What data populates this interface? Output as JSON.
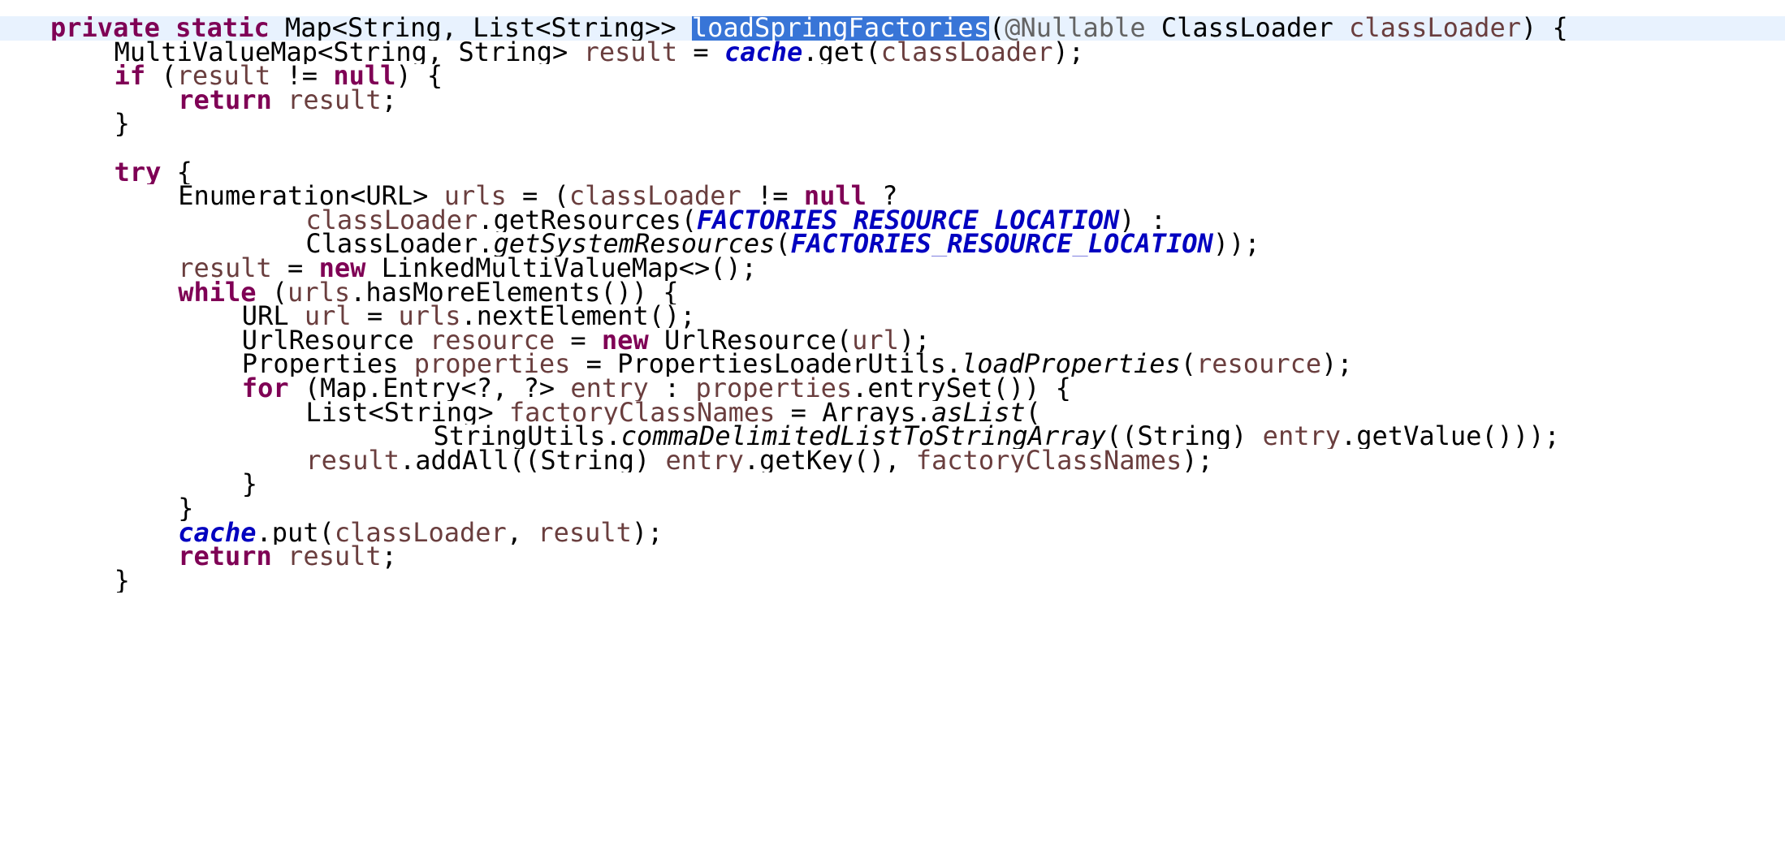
{
  "editor": {
    "lines": [
      {
        "indent": 0,
        "current": true,
        "tokens": [
          {
            "t": "private",
            "s": "kw"
          },
          {
            "t": " "
          },
          {
            "t": "static",
            "s": "kw"
          },
          {
            "t": " Map<String, List<String>> "
          },
          {
            "t": "loadSpringFactories",
            "s": "sel"
          },
          {
            "t": "("
          },
          {
            "t": "@Nullable",
            "s": "ann"
          },
          {
            "t": " ClassLoader "
          },
          {
            "t": "classLoader",
            "s": "var"
          },
          {
            "t": ") {"
          }
        ]
      },
      {
        "indent": 1,
        "tokens": [
          {
            "t": "MultiValueMap<String, String> "
          },
          {
            "t": "result",
            "s": "var"
          },
          {
            "t": " = "
          },
          {
            "t": "cache",
            "s": "field"
          },
          {
            "t": ".get("
          },
          {
            "t": "classLoader",
            "s": "var"
          },
          {
            "t": ");"
          }
        ]
      },
      {
        "indent": 1,
        "tokens": [
          {
            "t": "if",
            "s": "kw"
          },
          {
            "t": " ("
          },
          {
            "t": "result",
            "s": "var"
          },
          {
            "t": " != "
          },
          {
            "t": "null",
            "s": "kw"
          },
          {
            "t": ") {"
          }
        ]
      },
      {
        "indent": 2,
        "tokens": [
          {
            "t": "return",
            "s": "kw"
          },
          {
            "t": " "
          },
          {
            "t": "result",
            "s": "var"
          },
          {
            "t": ";"
          }
        ]
      },
      {
        "indent": 1,
        "tokens": [
          {
            "t": "}"
          }
        ]
      },
      {
        "indent": 0,
        "tokens": []
      },
      {
        "indent": 1,
        "tokens": [
          {
            "t": "try",
            "s": "kw"
          },
          {
            "t": " {"
          }
        ]
      },
      {
        "indent": 2,
        "tokens": [
          {
            "t": "Enumeration<URL> "
          },
          {
            "t": "urls",
            "s": "var"
          },
          {
            "t": " = ("
          },
          {
            "t": "classLoader",
            "s": "var"
          },
          {
            "t": " != "
          },
          {
            "t": "null",
            "s": "kw"
          },
          {
            "t": " ?"
          }
        ]
      },
      {
        "indent": 4,
        "tokens": [
          {
            "t": "classLoader",
            "s": "var"
          },
          {
            "t": ".getResources("
          },
          {
            "t": "FACTORIES_RESOURCE_LOCATION",
            "s": "field"
          },
          {
            "t": ") :"
          }
        ]
      },
      {
        "indent": 4,
        "tokens": [
          {
            "t": "ClassLoader."
          },
          {
            "t": "getSystemResources",
            "s": "sm"
          },
          {
            "t": "("
          },
          {
            "t": "FACTORIES_RESOURCE_LOCATION",
            "s": "field"
          },
          {
            "t": "));"
          }
        ]
      },
      {
        "indent": 2,
        "tokens": [
          {
            "t": "result",
            "s": "var"
          },
          {
            "t": " = "
          },
          {
            "t": "new",
            "s": "kw"
          },
          {
            "t": " LinkedMultiValueMap<>();"
          }
        ]
      },
      {
        "indent": 2,
        "tokens": [
          {
            "t": "while",
            "s": "kw"
          },
          {
            "t": " ("
          },
          {
            "t": "urls",
            "s": "var"
          },
          {
            "t": ".hasMoreElements()) {"
          }
        ]
      },
      {
        "indent": 3,
        "tokens": [
          {
            "t": "URL "
          },
          {
            "t": "url",
            "s": "var"
          },
          {
            "t": " = "
          },
          {
            "t": "urls",
            "s": "var"
          },
          {
            "t": ".nextElement();"
          }
        ]
      },
      {
        "indent": 3,
        "tokens": [
          {
            "t": "UrlResource "
          },
          {
            "t": "resource",
            "s": "var"
          },
          {
            "t": " = "
          },
          {
            "t": "new",
            "s": "kw"
          },
          {
            "t": " UrlResource("
          },
          {
            "t": "url",
            "s": "var"
          },
          {
            "t": ");"
          }
        ]
      },
      {
        "indent": 3,
        "tokens": [
          {
            "t": "Properties "
          },
          {
            "t": "properties",
            "s": "var"
          },
          {
            "t": " = PropertiesLoaderUtils."
          },
          {
            "t": "loadProperties",
            "s": "sm"
          },
          {
            "t": "("
          },
          {
            "t": "resource",
            "s": "var"
          },
          {
            "t": ");"
          }
        ]
      },
      {
        "indent": 3,
        "tokens": [
          {
            "t": "for",
            "s": "kw"
          },
          {
            "t": " (Map.Entry<?, ?> "
          },
          {
            "t": "entry",
            "s": "var"
          },
          {
            "t": " : "
          },
          {
            "t": "properties",
            "s": "var"
          },
          {
            "t": ".entrySet()) {"
          }
        ]
      },
      {
        "indent": 4,
        "tokens": [
          {
            "t": "List<String> "
          },
          {
            "t": "factoryClassNames",
            "s": "var"
          },
          {
            "t": " = Arrays."
          },
          {
            "t": "asList",
            "s": "sm"
          },
          {
            "t": "("
          }
        ]
      },
      {
        "indent": 6,
        "tokens": [
          {
            "t": "StringUtils."
          },
          {
            "t": "commaDelimitedListToStringArray",
            "s": "sm"
          },
          {
            "t": "((String) "
          },
          {
            "t": "entry",
            "s": "var"
          },
          {
            "t": ".getValue()));"
          }
        ]
      },
      {
        "indent": 4,
        "tokens": [
          {
            "t": "result",
            "s": "var"
          },
          {
            "t": ".addAll((String) "
          },
          {
            "t": "entry",
            "s": "var"
          },
          {
            "t": ".getKey(), "
          },
          {
            "t": "factoryClassNames",
            "s": "var"
          },
          {
            "t": ");"
          }
        ]
      },
      {
        "indent": 3,
        "tokens": [
          {
            "t": "}"
          }
        ]
      },
      {
        "indent": 2,
        "tokens": [
          {
            "t": "}"
          }
        ]
      },
      {
        "indent": 2,
        "tokens": [
          {
            "t": "cache",
            "s": "field"
          },
          {
            "t": ".put("
          },
          {
            "t": "classLoader",
            "s": "var"
          },
          {
            "t": ", "
          },
          {
            "t": "result",
            "s": "var"
          },
          {
            "t": ");"
          }
        ]
      },
      {
        "indent": 2,
        "tokens": [
          {
            "t": "return",
            "s": "kw"
          },
          {
            "t": " "
          },
          {
            "t": "result",
            "s": "var"
          },
          {
            "t": ";"
          }
        ]
      },
      {
        "indent": 1,
        "tokens": [
          {
            "t": "}"
          }
        ]
      }
    ]
  }
}
